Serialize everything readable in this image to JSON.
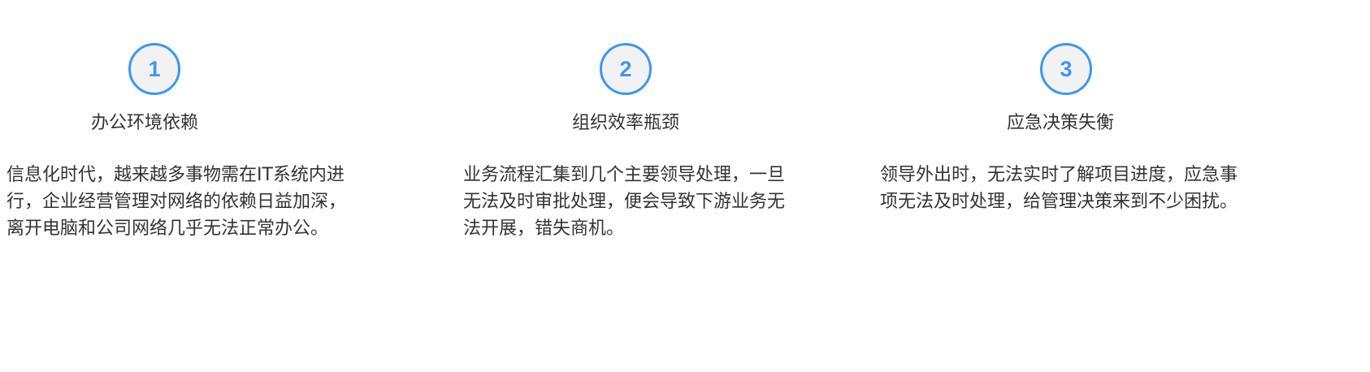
{
  "steps": [
    {
      "number": "1",
      "title": "办公环境依赖",
      "lines": [
        "信息化时代，越来越多事物需在IT系统内进",
        "行，企业经营管理对网络的依赖日益加深，",
        "离开电脑和公司网络几乎无法正常办公。"
      ]
    },
    {
      "number": "2",
      "title": "组织效率瓶颈",
      "lines": [
        "业务流程汇集到几个主要领导处理，一旦",
        "无法及时审批处理，便会导致下游业务无",
        "法开展，错失商机。"
      ]
    },
    {
      "number": "3",
      "title": "应急决策失衡",
      "lines": [
        "领导外出时，无法实时了解项目进度，应急事",
        "项无法及时处理，给管理决策来到不少困扰。"
      ]
    }
  ],
  "colors": {
    "accent": "#3b97f5",
    "badge_fill": "#f2f2f2",
    "text": "#333333"
  }
}
